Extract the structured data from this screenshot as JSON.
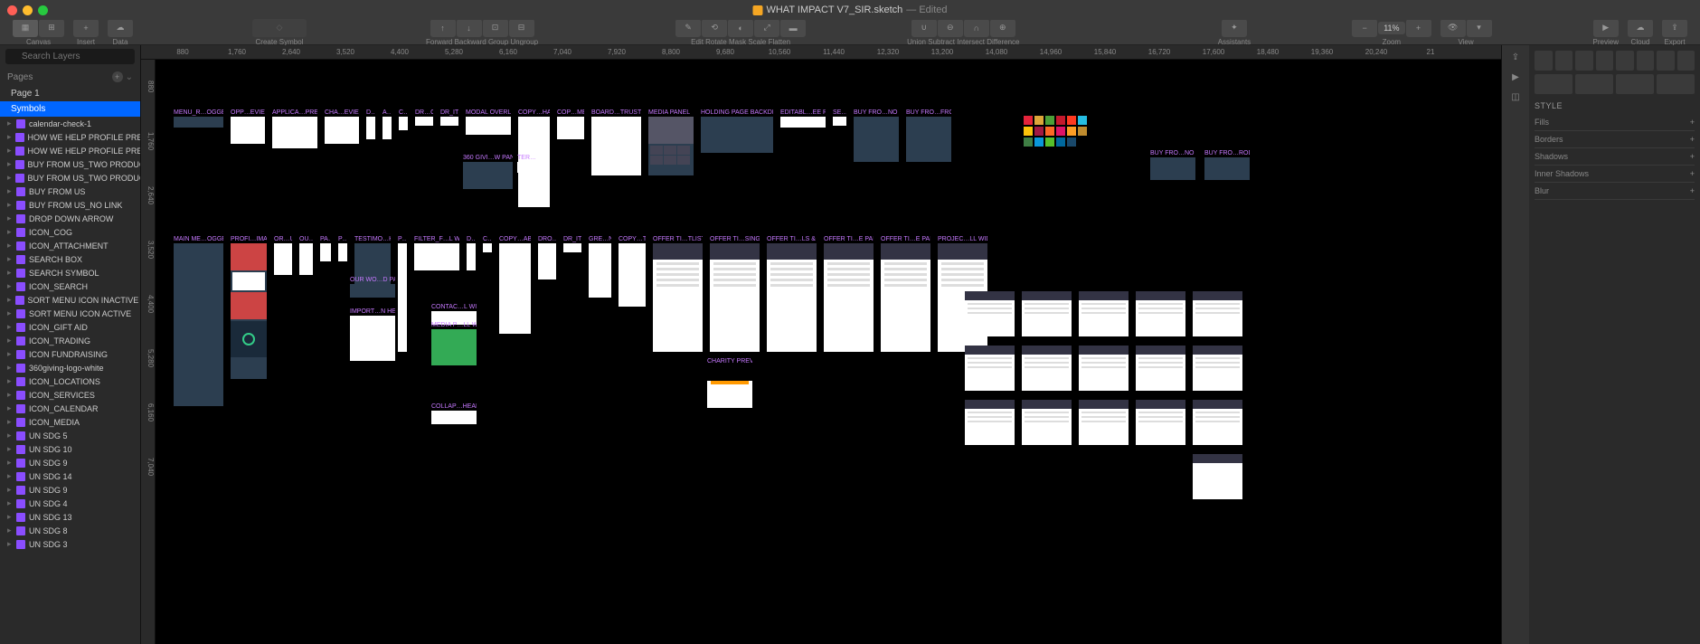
{
  "title": "WHAT IMPACT V7_SIR.sketch",
  "title_status": "— Edited",
  "toolbar": {
    "canvas": "Canvas",
    "insert": "Insert",
    "data": "Data",
    "create_symbol": "Create Symbol",
    "forward": "Forward",
    "backward": "Backward",
    "group": "Group",
    "ungroup": "Ungroup",
    "edit": "Edit",
    "rotate": "Rotate",
    "mask": "Mask",
    "scale": "Scale",
    "flatten": "Flatten",
    "union": "Union",
    "subtract": "Subtract",
    "intersect": "Intersect",
    "difference": "Difference",
    "assistants": "Assistants",
    "zoom": "Zoom",
    "view": "View",
    "preview": "Preview",
    "cloud": "Cloud",
    "export": "Export"
  },
  "zoom_level": "11%",
  "left": {
    "search_placeholder": "Search Layers",
    "pages_header": "Pages",
    "pages": [
      "Page 1",
      "Symbols"
    ],
    "selected_page": 1,
    "layers": [
      "calendar-check-1",
      "HOW WE HELP PROFILE PREVIEW WI…",
      "HOW WE HELP PROFILE PREVIEW",
      "BUY FROM US_TWO PRODUCT",
      "BUY FROM US_TWO PRODUCT_NO LI…",
      "BUY FROM US",
      "BUY FROM US_NO LINK",
      "DROP DOWN ARROW",
      "ICON_COG",
      "ICON_ATTACHMENT",
      "SEARCH BOX",
      "SEARCH SYMBOL",
      "ICON_SEARCH",
      "SORT MENU ICON INACTIVE",
      "SORT MENU ICON ACTIVE",
      "ICON_GIFT AID",
      "ICON_TRADING",
      "ICON FUNDRAISING",
      "360giving-logo-white",
      "ICON_LOCATIONS",
      "ICON_SERVICES",
      "ICON_CALENDAR",
      "ICON_MEDIA",
      "UN SDG 5",
      "UN SDG 10",
      "UN SDG 9",
      "UN SDG 14",
      "UN SDG 9",
      "UN SDG 4",
      "UN SDG 13",
      "UN SDG 8",
      "UN SDG 3"
    ]
  },
  "ruler_h": [
    "880",
    "1,760",
    "2,640",
    "3,520",
    "4,400",
    "5,280",
    "6,160",
    "7,040",
    "7,920",
    "8,800",
    "9,680",
    "10,560",
    "11,440",
    "12,320",
    "13,200",
    "14,080",
    "14,960",
    "15,840",
    "16,720",
    "17,600",
    "18,480",
    "19,360",
    "20,240",
    "21"
  ],
  "ruler_v": [
    "880",
    "1,760",
    "2,640",
    "3,520",
    "4,400",
    "5,280",
    "6,160",
    "7,040"
  ],
  "artboards_row1": [
    "MENU_R…OGGED IN",
    "OPP…EVIEW",
    "APPLICA…PREVIEW",
    "CHA…EVIEW",
    "D…RY",
    "A…Y",
    "C…LE",
    "DR…OWN",
    "DR_ITEM",
    "MODAL OVERLAY",
    "COPY…HARS",
    "COP…MED",
    "BOARD…TRUSTEES",
    "MEDIA PANEL",
    "HOLDING PAGE BACKDROP",
    "EDITABL…EE ROW",
    "SE…OX",
    "BUY FRO…NO LINK",
    "BUY FRO…FROM US"
  ],
  "artboards_row1b": [
    "360 GIVI…W PANEL",
    "TER…ANEL",
    "BUY FRO…NO LINK",
    "BUY FRO…RODUCT"
  ],
  "artboards_row2": [
    "MAIN ME…OGGED IN",
    "PROFI…IMAGE",
    "OR…UMN",
    "OU…N",
    "PA…T",
    "P…5",
    "TESTIMO…H_RIGHT",
    "P…L",
    "FILTER_F…L WIDTH",
    "D…AL",
    "C…LE",
    "COPY…ABLE",
    "DRO…IDE",
    "DR_ITEM",
    "GRE…NEL",
    "COPY…TERS",
    "OFFER TI…TLISTED",
    "OFFER TI…SINGLE",
    "OFFER TI…LS & TIME",
    "OFFER TI…E PAIRED",
    "OFFER TI…E PAIRED",
    "PROJEC…LL WIDTH"
  ],
  "artboards_row3": [
    "OUR WO…D PANEL",
    "IMPORT…N HEADER",
    "CONTAC…L WIDTH",
    "MEDIA P…LL WIDTH",
    "CHARITY PREVIEW"
  ],
  "artboards_row4": [
    "COLLAP…HEADER"
  ],
  "inspector": {
    "style": "STYLE",
    "fills": "Fills",
    "borders": "Borders",
    "shadows": "Shadows",
    "inner_shadows": "Inner Shadows",
    "blur": "Blur"
  }
}
